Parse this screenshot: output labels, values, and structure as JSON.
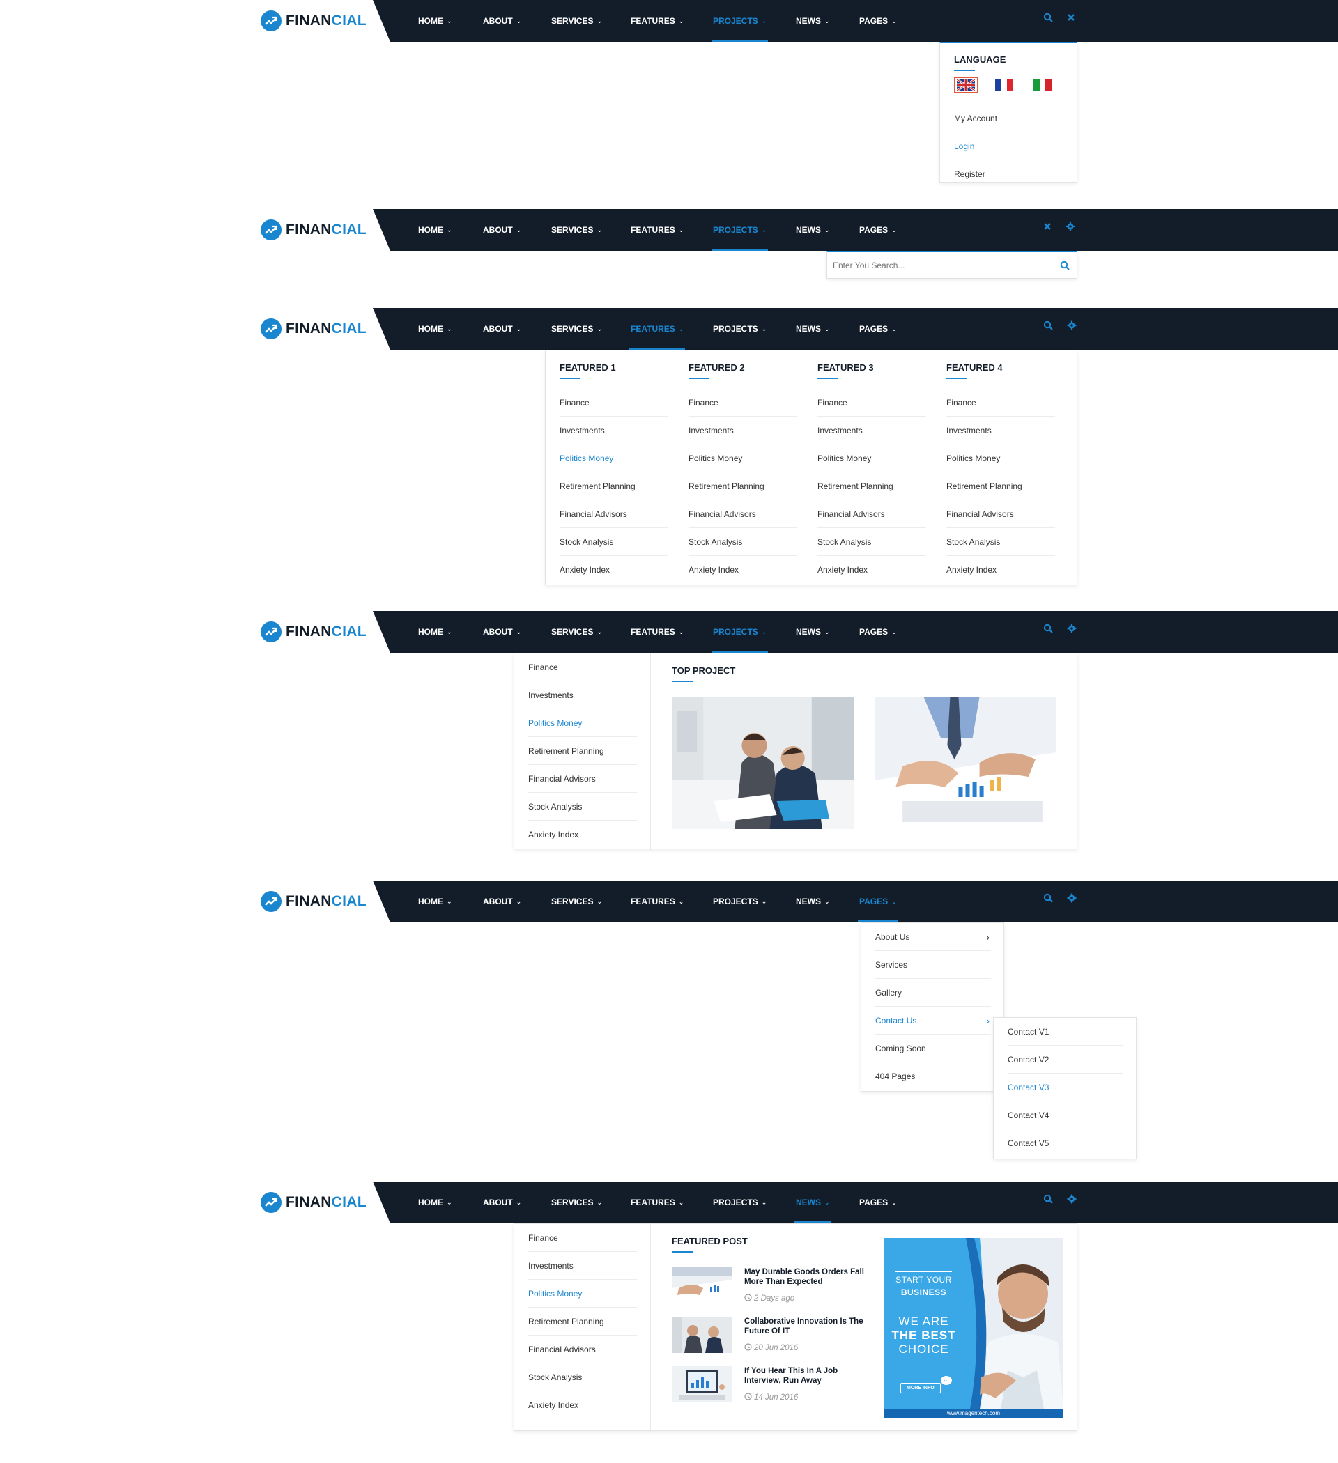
{
  "brand": {
    "name_dark": "FINAN",
    "name_blue": "CIAL"
  },
  "nav_labels": [
    "HOME",
    "ABOUT",
    "SERVICES",
    "FEATURES",
    "PROJECTS",
    "NEWS",
    "PAGES"
  ],
  "colors": {
    "navbar": "#131d2a",
    "accent": "#1a86d0",
    "text": "#333333"
  },
  "sections": [
    {
      "active_nav": "PROJECTS",
      "right_icons": [
        "search-icon",
        "close-icon"
      ]
    },
    {
      "active_nav": "PROJECTS",
      "right_icons": [
        "close-icon",
        "gear-icon"
      ]
    },
    {
      "active_nav": "FEATURES",
      "right_icons": [
        "search-icon",
        "gear-icon"
      ]
    },
    {
      "active_nav": "PROJECTS",
      "right_icons": [
        "search-icon",
        "gear-icon"
      ]
    },
    {
      "active_nav": "PAGES",
      "right_icons": [
        "search-icon",
        "gear-icon"
      ]
    },
    {
      "active_nav": "NEWS",
      "right_icons": [
        "search-icon",
        "gear-icon"
      ]
    }
  ],
  "language_panel": {
    "heading": "LANGUAGE",
    "flags": [
      "uk-flag-icon",
      "france-flag-icon",
      "italy-flag-icon"
    ],
    "links": [
      {
        "label": "My Account",
        "active": false
      },
      {
        "label": "Login",
        "active": true
      },
      {
        "label": "Register",
        "active": false
      }
    ]
  },
  "search": {
    "placeholder": "Enter You Search..."
  },
  "features_menu": {
    "columns": [
      {
        "heading": "FEATURED 1",
        "items": [
          "Finance",
          "Investments",
          "Politics Money",
          "Retirement Planning",
          "Financial Advisors",
          "Stock Analysis",
          "Anxiety Index"
        ],
        "active_index": 2
      },
      {
        "heading": "FEATURED 2",
        "items": [
          "Finance",
          "Investments",
          "Politics Money",
          "Retirement Planning",
          "Financial Advisors",
          "Stock Analysis",
          "Anxiety Index"
        ],
        "active_index": -1
      },
      {
        "heading": "FEATURED 3",
        "items": [
          "Finance",
          "Investments",
          "Politics Money",
          "Retirement Planning",
          "Financial Advisors",
          "Stock Analysis",
          "Anxiety Index"
        ],
        "active_index": -1
      },
      {
        "heading": "FEATURED 4",
        "items": [
          "Finance",
          "Investments",
          "Politics Money",
          "Retirement Planning",
          "Financial Advisors",
          "Stock Analysis",
          "Anxiety Index"
        ],
        "active_index": -1
      }
    ]
  },
  "projects_menu": {
    "items": [
      "Finance",
      "Investments",
      "Politics Money",
      "Retirement Planning",
      "Financial Advisors",
      "Stock Analysis",
      "Anxiety Index"
    ],
    "active_index": 2,
    "heading": "TOP PROJECT"
  },
  "pages_menu": {
    "items": [
      {
        "label": "About Us",
        "has_sub": true,
        "active": false
      },
      {
        "label": "Services",
        "has_sub": false,
        "active": false
      },
      {
        "label": "Gallery",
        "has_sub": false,
        "active": false
      },
      {
        "label": "Contact Us",
        "has_sub": true,
        "active": true
      },
      {
        "label": "Coming Soon",
        "has_sub": false,
        "active": false
      },
      {
        "label": "404 Pages",
        "has_sub": false,
        "active": false
      }
    ],
    "submenu": {
      "items": [
        "Contact V1",
        "Contact V2",
        "Contact V3",
        "Contact V4",
        "Contact V5"
      ],
      "active_index": 2
    }
  },
  "news_menu": {
    "items": [
      "Finance",
      "Investments",
      "Politics Money",
      "Retirement Planning",
      "Financial Advisors",
      "Stock Analysis",
      "Anxiety Index"
    ],
    "active_index": 2,
    "heading": "FEATURED POST",
    "posts": [
      {
        "title": "May Durable Goods Orders Fall More Than Expected",
        "date": "2 Days ago"
      },
      {
        "title": "Collaborative Innovation Is The Future Of IT",
        "date": "20 Jun 2016"
      },
      {
        "title": "If You Hear This In A Job Interview, Run Away",
        "date": "14 Jun 2016"
      }
    ],
    "banner": {
      "line1": "START YOUR",
      "line2": "BUSINESS",
      "line3": "WE ARE",
      "line4": "THE BEST",
      "line5": "CHOICE",
      "button": "MORE INFO",
      "url": "www.magentech.com"
    }
  }
}
